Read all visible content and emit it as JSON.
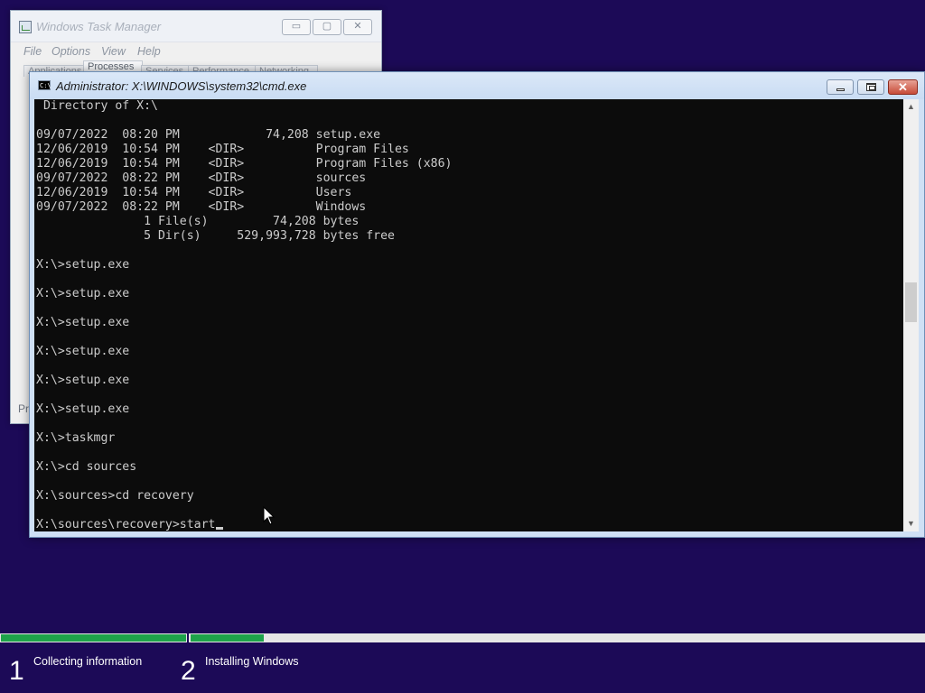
{
  "task_manager": {
    "title": "Windows Task Manager",
    "menu": [
      "File",
      "Options",
      "View",
      "Help"
    ],
    "tabs": [
      "Applications",
      "Processes",
      "Services",
      "Performance",
      "Networking"
    ],
    "active_tab": "Processes",
    "status_text": "Pr",
    "controls": {
      "minimize": "▭",
      "maximize": "▢",
      "close": "✕"
    }
  },
  "cmd": {
    "title": "Administrator: X:\\WINDOWS\\system32\\cmd.exe",
    "icon_label": "C:\\",
    "close_glyph": "✕",
    "lines": [
      " Directory of X:\\",
      "",
      "09/07/2022  08:20 PM            74,208 setup.exe",
      "12/06/2019  10:54 PM    <DIR>          Program Files",
      "12/06/2019  10:54 PM    <DIR>          Program Files (x86)",
      "09/07/2022  08:22 PM    <DIR>          sources",
      "12/06/2019  10:54 PM    <DIR>          Users",
      "09/07/2022  08:22 PM    <DIR>          Windows",
      "               1 File(s)         74,208 bytes",
      "               5 Dir(s)     529,993,728 bytes free",
      "",
      "X:\\>setup.exe",
      "",
      "X:\\>setup.exe",
      "",
      "X:\\>setup.exe",
      "",
      "X:\\>setup.exe",
      "",
      "X:\\>setup.exe",
      "",
      "X:\\>setup.exe",
      "",
      "X:\\>taskmgr",
      "",
      "X:\\>cd sources",
      "",
      "X:\\sources>cd recovery",
      ""
    ],
    "current_input": "X:\\sources\\recovery>start",
    "scroll_up_glyph": "▲",
    "scroll_down_glyph": "▼"
  },
  "setup_progress": {
    "steps": [
      {
        "number": "1",
        "label": "Collecting information"
      },
      {
        "number": "2",
        "label": "Installing Windows"
      }
    ],
    "step1_fill": 1.0,
    "step2_fill": 0.1,
    "accent_color": "#1ea34a",
    "background_color": "#1c0a57"
  }
}
